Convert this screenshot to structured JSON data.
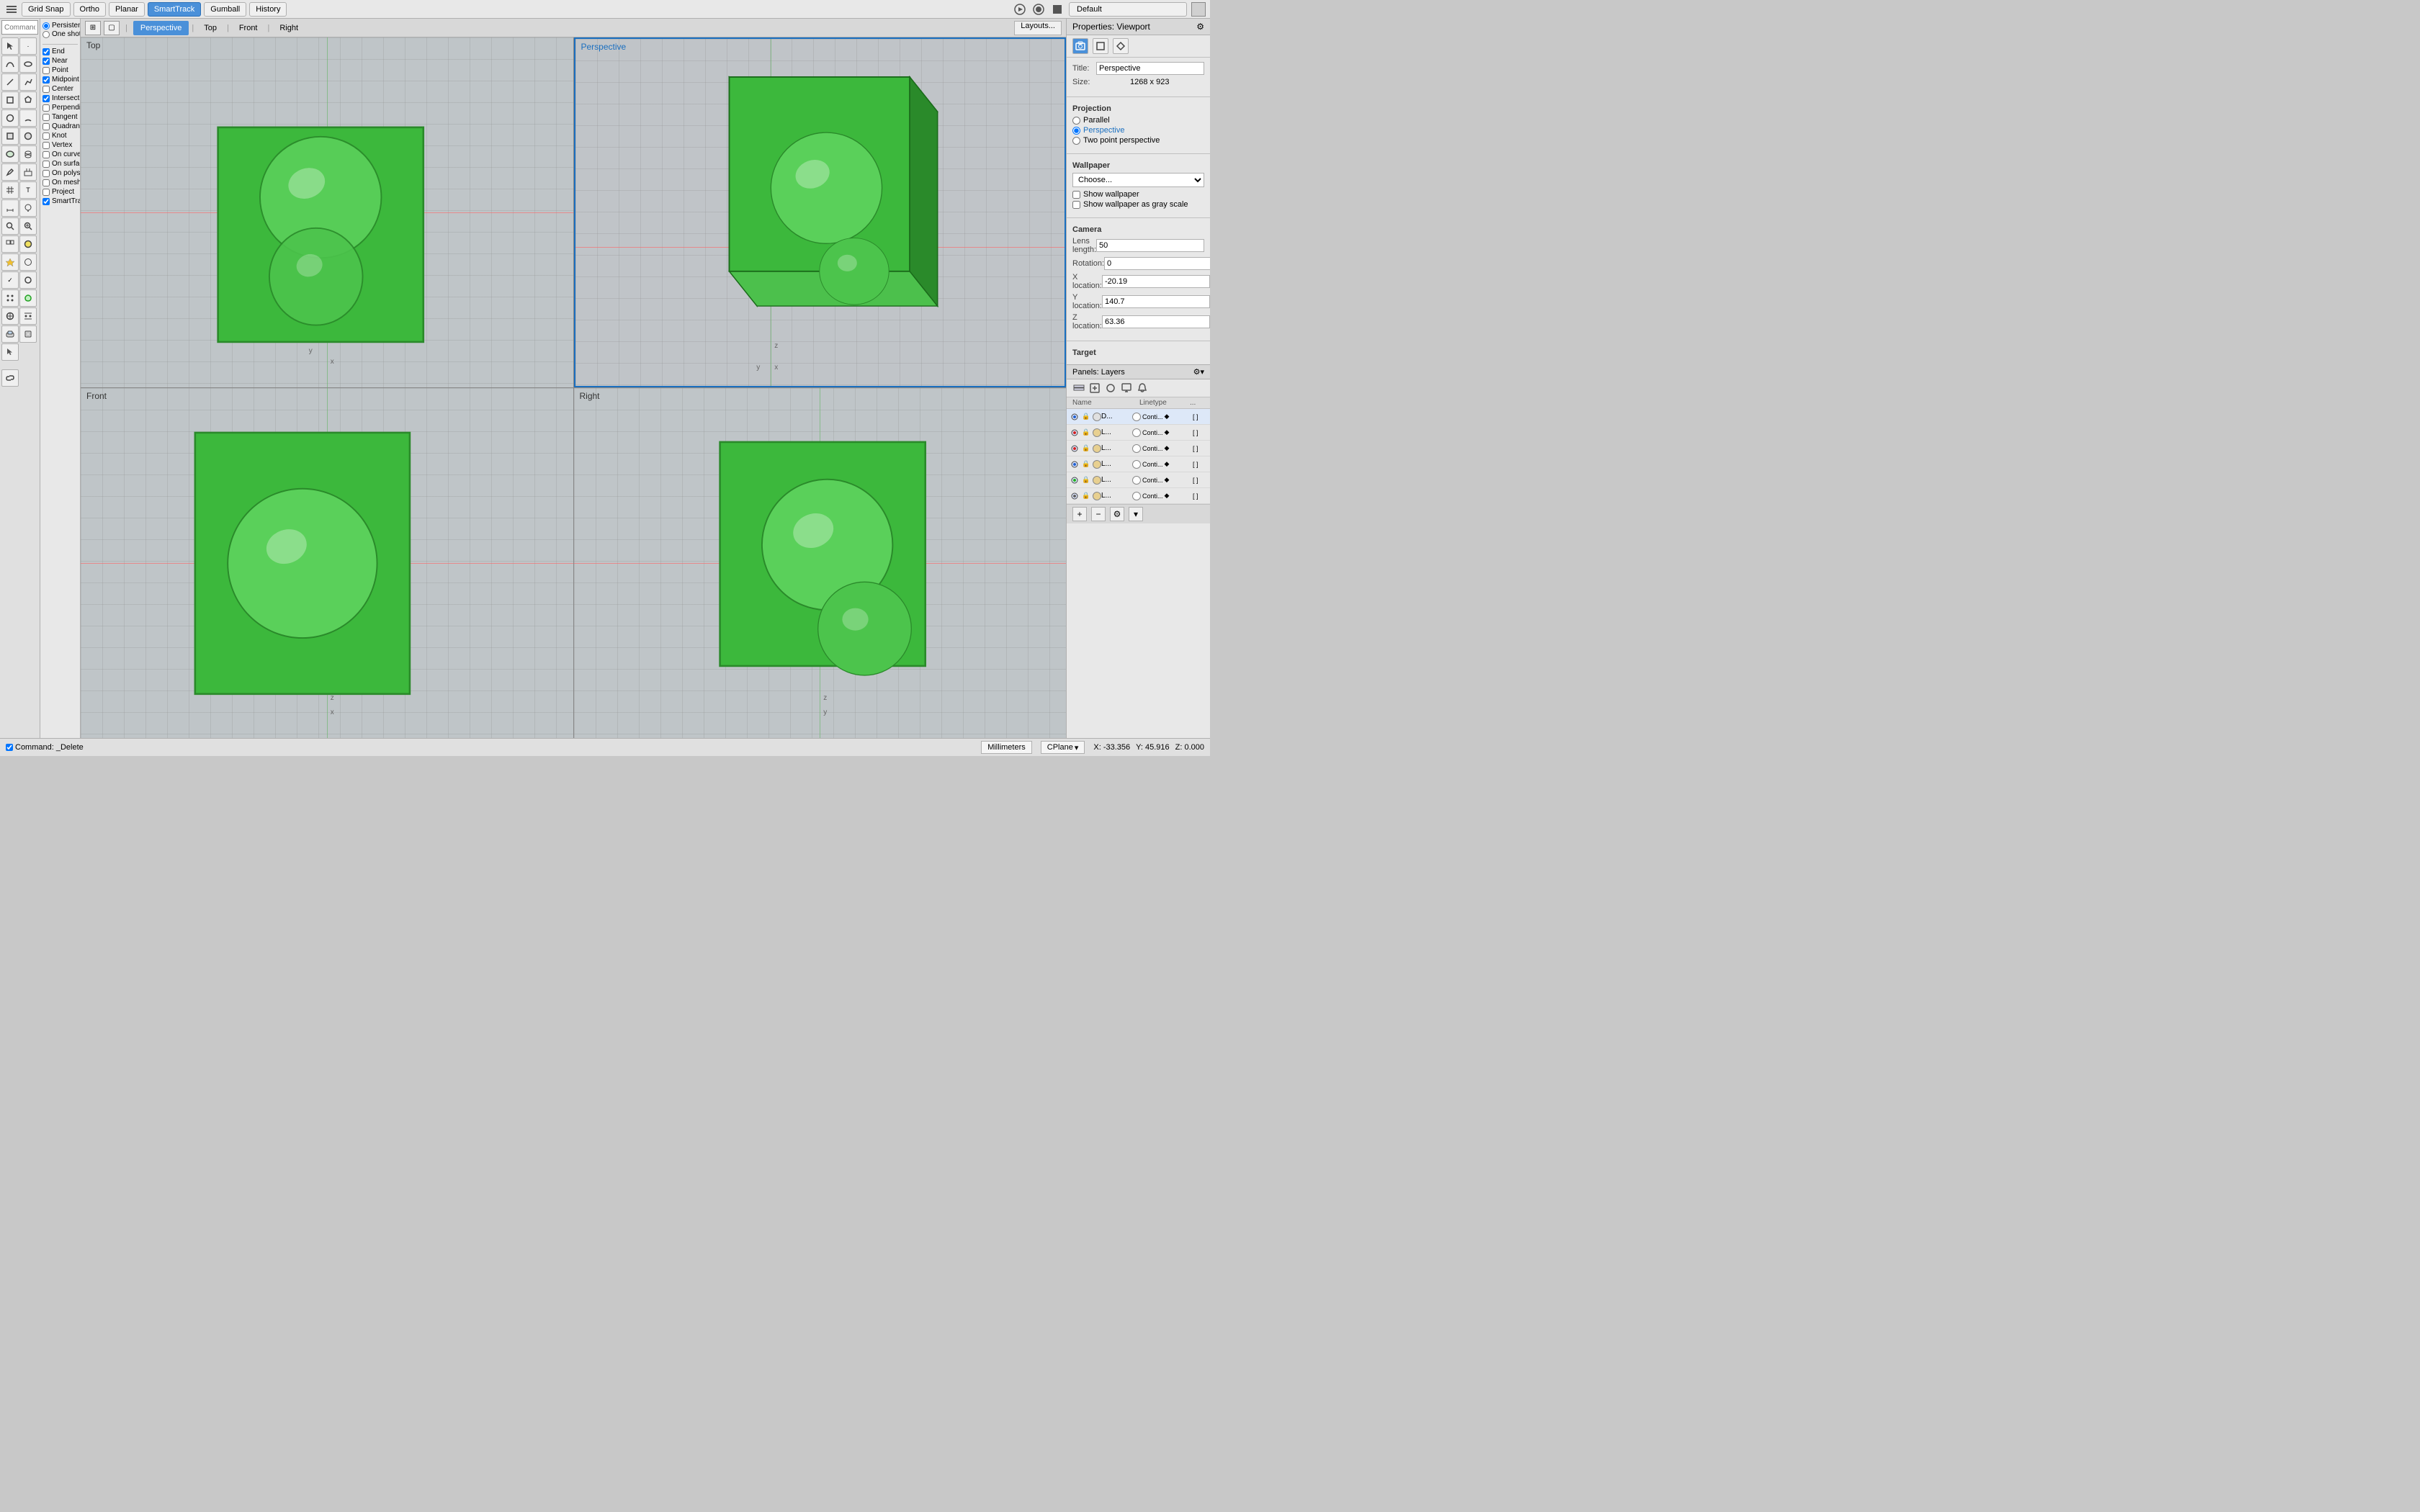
{
  "toolbar": {
    "grid_snap": "Grid Snap",
    "ortho": "Ortho",
    "planar": "Planar",
    "smart_track": "SmartTrack",
    "gumball": "Gumball",
    "history": "History",
    "default_label": "Default"
  },
  "viewport_tabs": {
    "grid_icon": "⊞",
    "tab1": "Perspective",
    "tab2": "Top",
    "tab3": "Front",
    "tab4": "Right",
    "layouts": "Layouts..."
  },
  "viewports": {
    "top_label": "Top",
    "persp_label": "Perspective",
    "front_label": "Front",
    "right_label": "Right"
  },
  "command": {
    "placeholder": "Command",
    "status": "Command: _Delete"
  },
  "snap_panel": {
    "persistent": "Persistent",
    "one_shot": "One shot",
    "end": "End",
    "near": "Near",
    "point": "Point",
    "midpoint": "Midpoint",
    "center": "Center",
    "intersection": "Intersection",
    "perpendicular": "Perpendicular",
    "tangent": "Tangent",
    "quadrant": "Quadrant",
    "knot": "Knot",
    "vertex": "Vertex",
    "on_curve": "On curve",
    "on_surface": "On surface",
    "on_polysurface": "On polysurface",
    "on_mesh": "On mesh",
    "project": "Project",
    "smart_track": "SmartTrack"
  },
  "properties_panel": {
    "title": "Properties: Viewport",
    "viewport_title": "Perspective",
    "size": "1268 x 923",
    "projection_label": "Projection",
    "parallel": "Parallel",
    "perspective": "Perspective",
    "two_point": "Two point perspective",
    "wallpaper_label": "Wallpaper",
    "choose": "Choose...",
    "show_wallpaper": "Show wallpaper",
    "show_grayscale": "Show wallpaper as gray scale",
    "camera_label": "Camera",
    "lens_length_label": "Lens length:",
    "lens_length_val": "50",
    "rotation_label": "Rotation:",
    "rotation_val": "0",
    "x_location_label": "X location:",
    "x_location_val": "-20.19",
    "y_location_label": "Y location:",
    "y_location_val": "140.7",
    "z_location_label": "Z location:",
    "z_location_val": "63.36",
    "target_label": "Target"
  },
  "layers_panel": {
    "title": "Panels: Layers",
    "col_name": "Name",
    "col_linetype": "Linetype",
    "col_more": "...",
    "layers": [
      {
        "name": "D...",
        "color": "#2060d0",
        "swatch": "#e0e0e0",
        "linetype": "Conti...",
        "active": true
      },
      {
        "name": "L...",
        "color": "#d02020",
        "swatch": "#e8d090",
        "linetype": "Conti...",
        "active": false
      },
      {
        "name": "L...",
        "color": "#d02020",
        "swatch": "#e8d090",
        "linetype": "Conti...",
        "active": false
      },
      {
        "name": "L...",
        "color": "#2060d0",
        "swatch": "#e8d090",
        "linetype": "Conti...",
        "active": false
      },
      {
        "name": "L...",
        "color": "#20b020",
        "swatch": "#e8d090",
        "linetype": "Conti...",
        "active": false
      },
      {
        "name": "L...",
        "color": "#606060",
        "swatch": "#e8d090",
        "linetype": "Conti...",
        "active": false
      }
    ]
  },
  "status_bar": {
    "command_status": "Command: _Delete",
    "millimeters": "Millimeters",
    "cplane": "CPlane",
    "x_coord": "X: -33.356",
    "y_coord": "Y: 45.916",
    "z_coord": "Z: 0.000"
  },
  "colors": {
    "active_blue": "#4a90d9",
    "green_object": "#3cb83c",
    "viewport_bg": "#b8b8b8",
    "persp_border": "#1a6fc0"
  }
}
